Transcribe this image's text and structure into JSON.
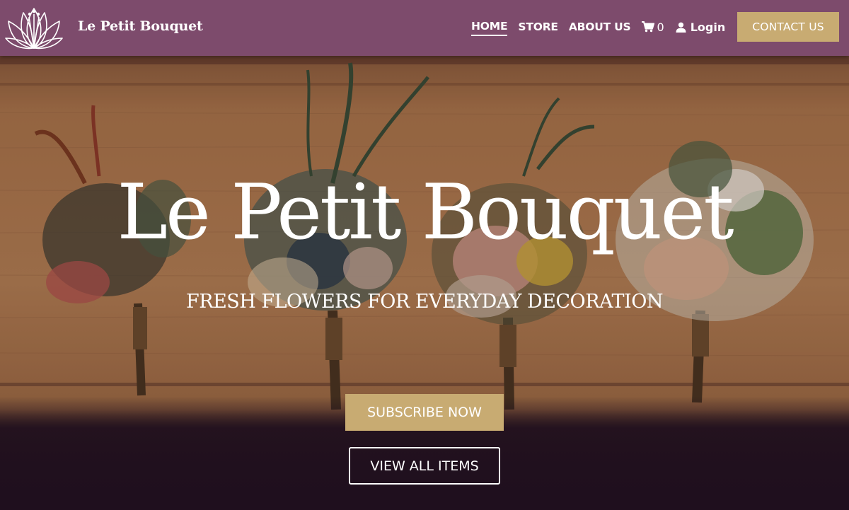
{
  "header": {
    "brand": "Le Petit Bouquet",
    "nav": [
      {
        "label": "HOME",
        "active": true
      },
      {
        "label": "STORE",
        "active": false
      },
      {
        "label": "ABOUT US",
        "active": false
      }
    ],
    "cart_count": "0",
    "login_label": "Login",
    "contact_label": "CONTACT US"
  },
  "hero": {
    "title": "Le Petit Bouquet",
    "subtitle": "FRESH FLOWERS FOR EVERYDAY DECORATION",
    "subscribe_label": "SUBSCRIBE NOW",
    "view_label": "VIEW ALL ITEMS"
  },
  "colors": {
    "header_bg": "#7d4b6c",
    "accent_gold": "#c8ab72",
    "dark_bg": "#1f0f1e",
    "wood": "#a8724a"
  },
  "icons": [
    "lotus-logo-icon",
    "cart-icon",
    "user-icon"
  ]
}
